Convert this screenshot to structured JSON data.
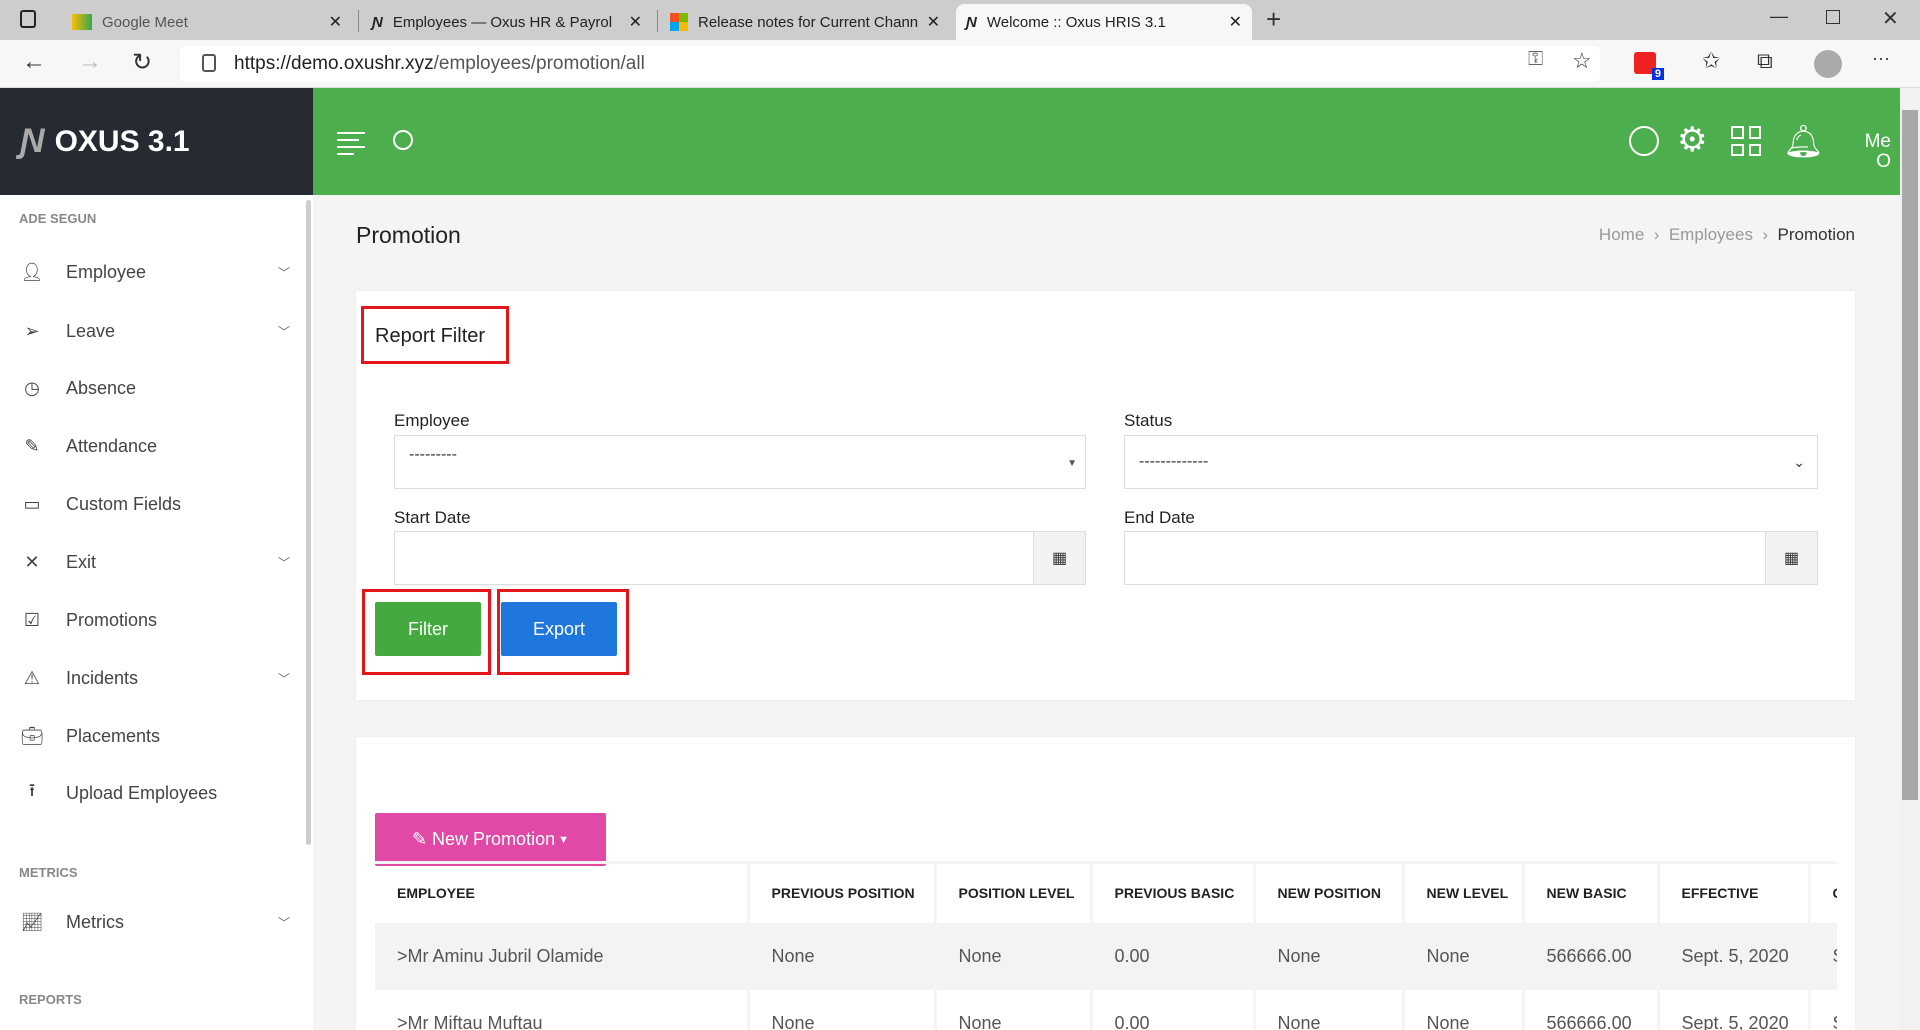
{
  "browser": {
    "tabs": [
      {
        "title": "Google Meet"
      },
      {
        "title": "Employees — Oxus HR & Payroll"
      },
      {
        "title": "Release notes for Current Channel"
      },
      {
        "title": "Welcome :: Oxus HRIS 3.1"
      }
    ],
    "url_host": "https://demo.oxushr.xyz",
    "url_path": "/employees/promotion/all",
    "extension_badge": "9"
  },
  "app": {
    "logo": "OXUS 3.1",
    "user_menu": "Me",
    "user_menu_sub": "O",
    "accent": "#4cae4c"
  },
  "sidebar": {
    "section_user": "ADE SEGUN",
    "items": [
      {
        "label": "Employee",
        "icon": "user-icon",
        "chevron": true
      },
      {
        "label": "Leave",
        "icon": "send-icon",
        "chevron": true
      },
      {
        "label": "Absence",
        "icon": "timer-icon",
        "chevron": false
      },
      {
        "label": "Attendance",
        "icon": "edit-icon",
        "chevron": false
      },
      {
        "label": "Custom Fields",
        "icon": "comment-icon",
        "chevron": false
      },
      {
        "label": "Exit",
        "icon": "close-icon",
        "chevron": true
      },
      {
        "label": "Promotions",
        "icon": "checkbox-icon",
        "chevron": false
      },
      {
        "label": "Incidents",
        "icon": "warning-icon",
        "chevron": true
      },
      {
        "label": "Placements",
        "icon": "briefcase-icon",
        "chevron": false
      },
      {
        "label": "Upload Employees",
        "icon": "upload-icon",
        "chevron": false
      }
    ],
    "section_metrics": "METRICS",
    "metrics": {
      "label": "Metrics",
      "icon": "chart-icon"
    },
    "section_reports": "REPORTS"
  },
  "page": {
    "title": "Promotion",
    "breadcrumb": [
      "Home",
      "Employees",
      "Promotion"
    ]
  },
  "filter": {
    "title": "Report Filter",
    "employee_label": "Employee",
    "employee_value": "---------",
    "status_label": "Status",
    "status_value": "-------------",
    "start_label": "Start Date",
    "start_value": "",
    "end_label": "End Date",
    "end_value": "",
    "filter_btn": "Filter",
    "export_btn": "Export"
  },
  "table": {
    "new_btn": "New Promotion",
    "columns": [
      "EMPLOYEE",
      "PREVIOUS POSITION",
      "POSITION LEVEL",
      "PREVIOUS BASIC",
      "NEW POSITION",
      "NEW LEVEL",
      "NEW BASIC",
      "EFFECTIVE",
      "C"
    ],
    "rows": [
      [
        ">Mr Aminu Jubril Olamide",
        "None",
        "None",
        "0.00",
        "None",
        "None",
        "566666.00",
        "Sept. 5, 2020",
        "S"
      ],
      [
        ">Mr Miftau Muftau",
        "None",
        "None",
        "0.00",
        "None",
        "None",
        "566666.00",
        "Sept. 5, 2020",
        "S"
      ]
    ]
  }
}
